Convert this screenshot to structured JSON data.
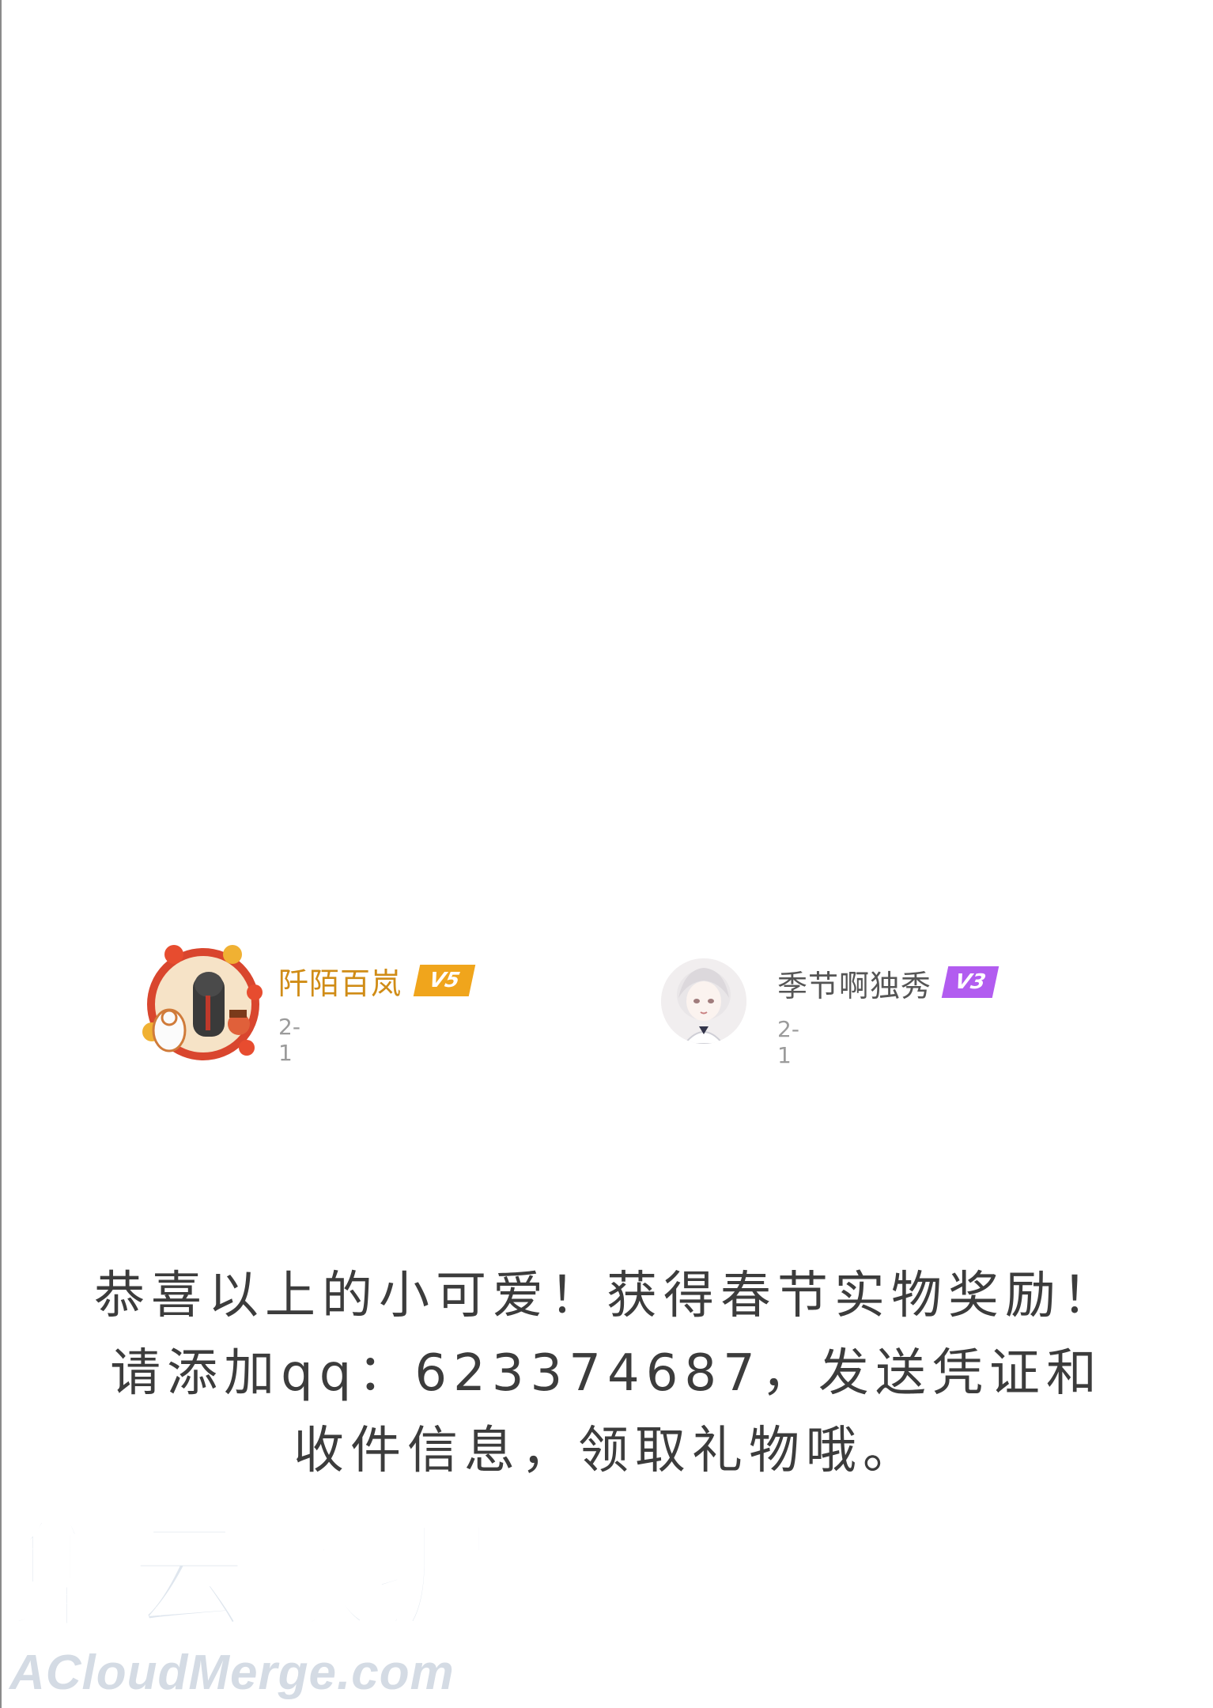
{
  "winners": [
    {
      "name": "阡陌百岚",
      "vip": "V5",
      "date": "2-1",
      "name_color": "#d08c16",
      "vip_color": "#f0a51c",
      "avatar_icon": "new-year-avatar-icon"
    },
    {
      "name": "季节啊独秀",
      "vip": "V3",
      "date": "2-1",
      "name_color": "#555555",
      "vip_color": "#b25cf0",
      "avatar_icon": "anime-girl-avatar-icon"
    }
  ],
  "announcement": {
    "line1": "恭喜以上的小可爱！获得春节实物奖励！",
    "line2": "请添加qq：623374687，发送凭证和",
    "line3": "收件信息，领取礼物哦。"
  },
  "watermark": {
    "cn": "集云数据",
    "en": "ACloudMerge.com"
  }
}
